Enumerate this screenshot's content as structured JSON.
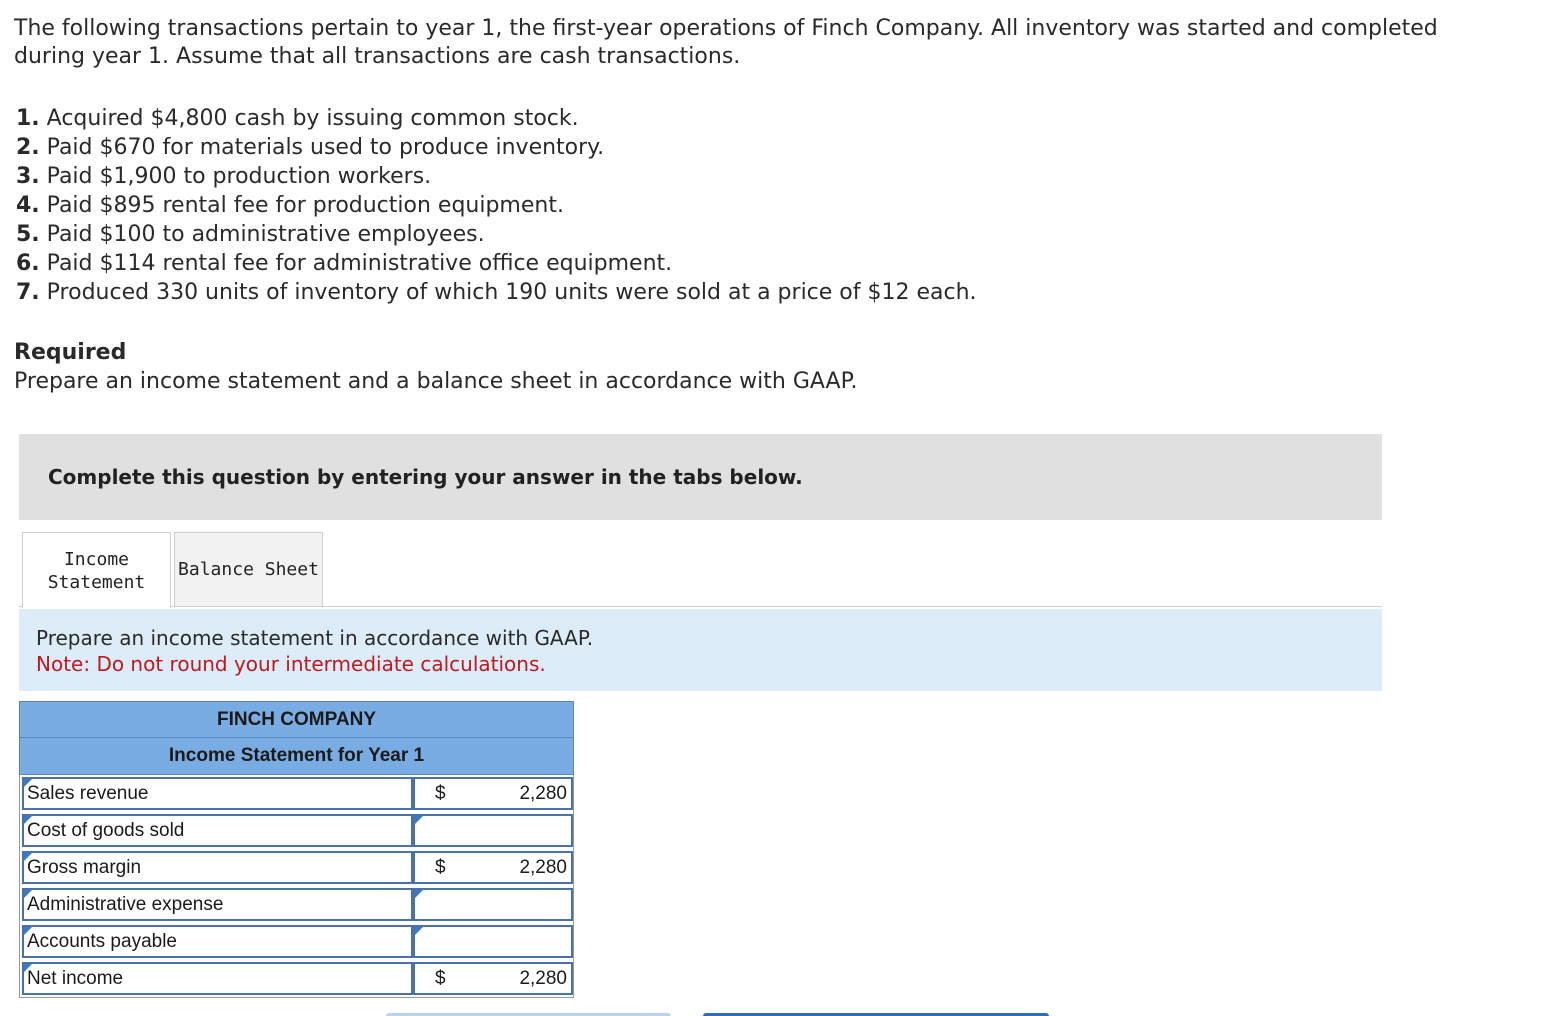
{
  "problem": {
    "intro": "The following transactions pertain to year 1, the first-year operations of Finch Company. All inventory was started and completed during year 1. Assume that all transactions are cash transactions.",
    "items": [
      {
        "num": "1.",
        "text": "Acquired $4,800 cash by issuing common stock."
      },
      {
        "num": "2.",
        "text": "Paid $670 for materials used to produce inventory."
      },
      {
        "num": "3.",
        "text": "Paid $1,900 to production workers."
      },
      {
        "num": "4.",
        "text": "Paid $895 rental fee for production equipment."
      },
      {
        "num": "5.",
        "text": "Paid $100 to administrative employees."
      },
      {
        "num": "6.",
        "text": "Paid $114 rental fee for administrative office equipment."
      },
      {
        "num": "7.",
        "text": "Produced 330 units of inventory of which 190 units were sold at a price of $12 each."
      }
    ],
    "required_title": "Required",
    "required_text": "Prepare an income statement and a balance sheet in accordance with GAAP."
  },
  "banner": "Complete this question by entering your answer in the tabs below.",
  "tabs": [
    {
      "label": "Income\nStatement",
      "active": true
    },
    {
      "label": "Balance Sheet",
      "active": false
    }
  ],
  "instructions": {
    "text": "Prepare an income statement in accordance with GAAP.",
    "note": "Note: Do not round your intermediate calculations."
  },
  "statement": {
    "company": "FINCH COMPANY",
    "title": "Income Statement for Year 1",
    "rows": [
      {
        "label": "Sales revenue",
        "dollar": "$",
        "value": "2,280"
      },
      {
        "label": "Cost of goods sold",
        "dollar": "",
        "value": ""
      },
      {
        "label": "Gross margin",
        "dollar": "$",
        "value": "2,280"
      },
      {
        "label": "Administrative expense",
        "dollar": "",
        "value": ""
      },
      {
        "label": "Accounts payable",
        "dollar": "",
        "value": ""
      },
      {
        "label": "Net income",
        "dollar": "$",
        "value": "2,280"
      }
    ]
  },
  "colors": {
    "header_blue": "#7aace4",
    "cell_border": "#4a72a8",
    "note_red": "#c0181c",
    "instr_bg": "#dcecf8"
  }
}
